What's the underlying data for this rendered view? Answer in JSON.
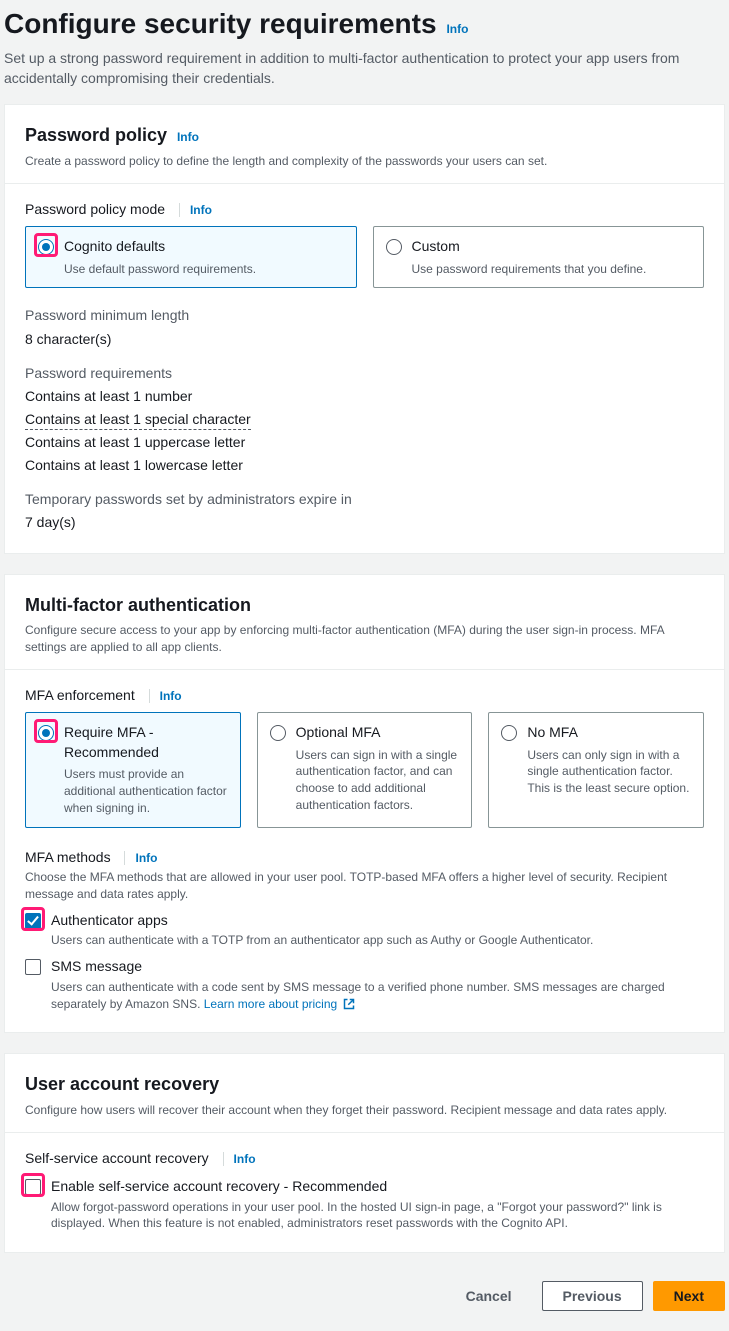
{
  "page": {
    "title": "Configure security requirements",
    "info": "Info",
    "description": "Set up a strong password requirement in addition to multi-factor authentication to protect your app users from accidentally compromising their credentials."
  },
  "password_policy": {
    "title": "Password policy",
    "info": "Info",
    "description": "Create a password policy to define the length and complexity of the passwords your users can set.",
    "mode_label": "Password policy mode",
    "mode_info": "Info",
    "options": {
      "defaults": {
        "title": "Cognito defaults",
        "desc": "Use default password requirements."
      },
      "custom": {
        "title": "Custom",
        "desc": "Use password requirements that you define."
      }
    },
    "min_length_label": "Password minimum length",
    "min_length_value": "8 character(s)",
    "req_label": "Password requirements",
    "reqs": {
      "r1": "Contains at least 1 number",
      "r2": "Contains at least 1 special character",
      "r3": "Contains at least 1 uppercase letter",
      "r4": "Contains at least 1 lowercase letter"
    },
    "temp_label": "Temporary passwords set by administrators expire in",
    "temp_value": "7 day(s)"
  },
  "mfa": {
    "title": "Multi-factor authentication",
    "description": "Configure secure access to your app by enforcing multi-factor authentication (MFA) during the user sign-in process. MFA settings are applied to all app clients.",
    "enforcement_label": "MFA enforcement",
    "enforcement_info": "Info",
    "options": {
      "require": {
        "title": "Require MFA - Recommended",
        "desc": "Users must provide an additional authentication factor when signing in."
      },
      "optional": {
        "title": "Optional MFA",
        "desc": "Users can sign in with a single authentication factor, and can choose to add additional authentication factors."
      },
      "none": {
        "title": "No MFA",
        "desc": "Users can only sign in with a single authentication factor. This is the least secure option."
      }
    },
    "methods_label": "MFA methods",
    "methods_info": "Info",
    "methods_desc": "Choose the MFA methods that are allowed in your user pool. TOTP-based MFA offers a higher level of security. Recipient message and data rates apply.",
    "checks": {
      "auth_app": {
        "title": "Authenticator apps",
        "desc": "Users can authenticate with a TOTP from an authenticator app such as Authy or Google Authenticator."
      },
      "sms": {
        "title": "SMS message",
        "desc": "Users can authenticate with a code sent by SMS message to a verified phone number. SMS messages are charged separately by Amazon SNS. ",
        "link": "Learn more about pricing"
      }
    }
  },
  "recovery": {
    "title": "User account recovery",
    "description": "Configure how users will recover their account when they forget their password. Recipient message and data rates apply.",
    "self_label": "Self-service account recovery",
    "self_info": "Info",
    "check": {
      "title": "Enable self-service account recovery - Recommended",
      "desc": "Allow forgot-password operations in your user pool. In the hosted UI sign-in page, a \"Forgot your password?\" link is displayed. When this feature is not enabled, administrators reset passwords with the Cognito API."
    }
  },
  "footer": {
    "cancel": "Cancel",
    "previous": "Previous",
    "next": "Next"
  }
}
